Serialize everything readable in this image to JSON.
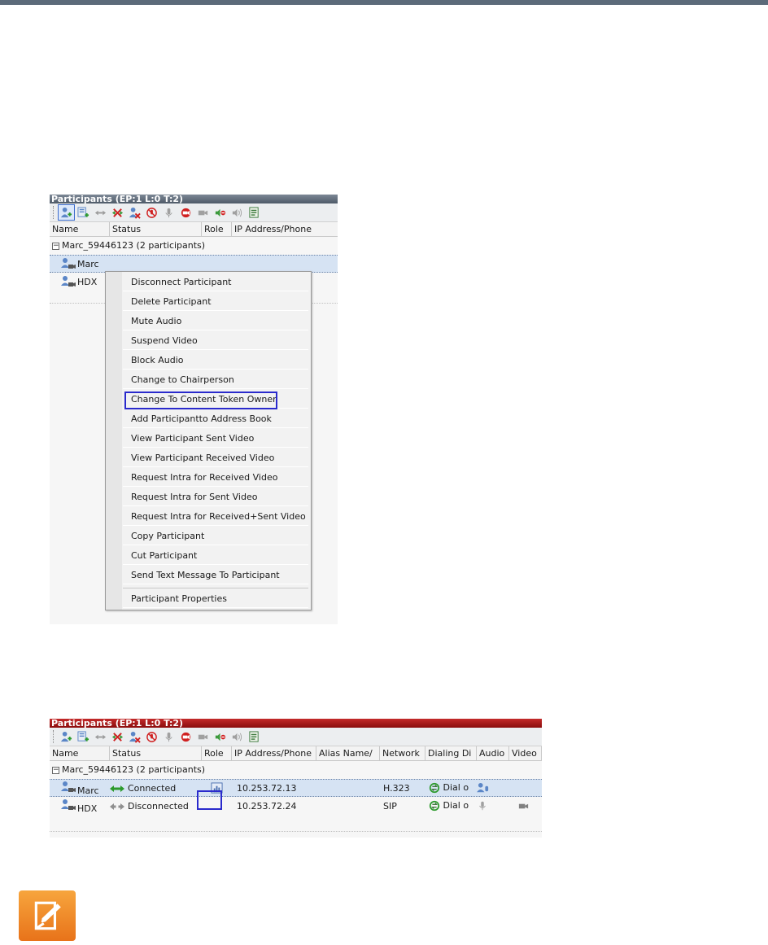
{
  "panel1": {
    "title": "Participants (EP:1 L:0 T:2)",
    "columns": [
      "Name",
      "Status",
      "Role",
      "IP Address/Phone"
    ],
    "group_label": "Marc_59446123 (2  participants)",
    "rows": [
      {
        "name": "Marc"
      },
      {
        "name": "HDX"
      }
    ]
  },
  "context_menu": {
    "items": [
      "Disconnect Participant",
      "Delete Participant",
      "Mute Audio",
      "Suspend Video",
      "Block Audio",
      "Change to Chairperson",
      "Change To Content Token Owner",
      "Add Participantto Address Book",
      "View Participant Sent Video",
      "View Participant Received Video",
      "Request Intra for Received Video",
      "Request Intra for Sent Video",
      "Request Intra for Received+Sent Video",
      "Copy Participant",
      "Cut Participant",
      "Send Text Message To Participant"
    ],
    "last_item": "Participant Properties",
    "highlighted": "Change To Content Token Owner"
  },
  "panel2": {
    "title": "Participants (EP:1 L:0 T:2)",
    "columns": [
      "Name",
      "Status",
      "Role",
      "IP Address/Phone",
      "Alias Name/",
      "Network",
      "Dialing Di",
      "Audio",
      "Video"
    ],
    "group_label": "Marc_59446123 (2  participants)",
    "rows": [
      {
        "name": "Marc",
        "status": "Connected",
        "ip": "10.253.72.13",
        "network": "H.323",
        "dialing": "Dial o"
      },
      {
        "name": "HDX",
        "status": "Disconnected",
        "ip": "10.253.72.24",
        "network": "SIP",
        "dialing": "Dial o"
      }
    ]
  },
  "colors": {
    "header_gray": "#5c6b7a",
    "panel_red": "#8a0c0c",
    "highlight_blue": "#2a2acc",
    "note_orange": "#e8731a"
  }
}
